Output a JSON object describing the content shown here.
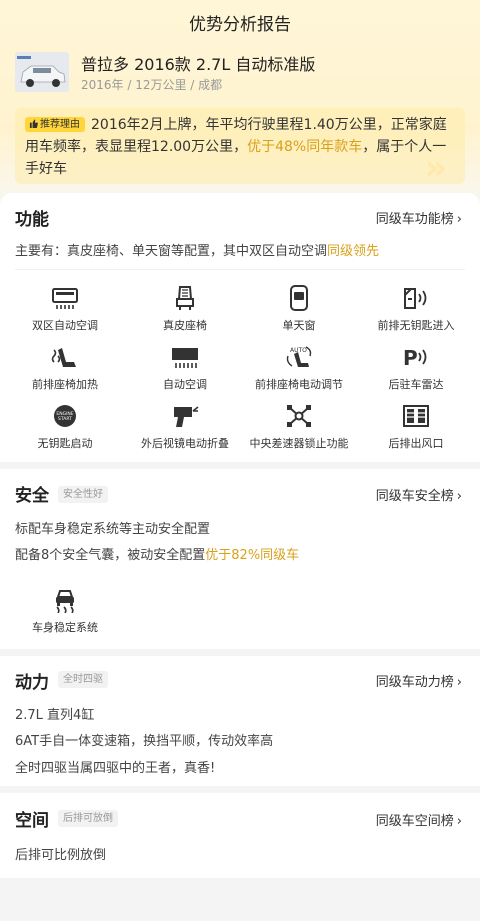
{
  "header": {
    "title": "优势分析报告"
  },
  "car": {
    "name": "普拉多 2016款 2.7L 自动标准版",
    "meta": "2016年 / 12万公里 / 成都"
  },
  "reason": {
    "tag": "推荐理由",
    "text_part1": "2016年2月上牌，年平均行驶里程1.40万公里，正常家庭用车频率，表显里程12.00万公里，",
    "highlight": "优于48%同年款车",
    "text_part2": "，属于个人一手好车"
  },
  "function": {
    "title": "功能",
    "link": "同级车功能榜",
    "summary_main": "主要有：真皮座椅、单天窗等配置，其中双区自动空调",
    "summary_hl": "同级领先",
    "features": [
      {
        "label": "双区自动空调",
        "icon": "dual-zone-ac-icon"
      },
      {
        "label": "真皮座椅",
        "icon": "leather-seat-icon"
      },
      {
        "label": "单天窗",
        "icon": "sunroof-icon"
      },
      {
        "label": "前排无钥匙进入",
        "icon": "keyless-entry-icon"
      },
      {
        "label": "前排座椅加热",
        "icon": "seat-heating-icon"
      },
      {
        "label": "自动空调",
        "icon": "auto-ac-icon"
      },
      {
        "label": "前排座椅电动调节",
        "icon": "power-seat-icon"
      },
      {
        "label": "后驻车雷达",
        "icon": "parking-radar-icon"
      },
      {
        "label": "无钥匙启动",
        "icon": "keyless-start-icon"
      },
      {
        "label": "外后视镜电动折叠",
        "icon": "mirror-fold-icon"
      },
      {
        "label": "中央差速器锁止功能",
        "icon": "diff-lock-icon"
      },
      {
        "label": "后排出风口",
        "icon": "rear-vent-icon"
      }
    ]
  },
  "safety": {
    "title": "安全",
    "tag": "安全性好",
    "link": "同级车安全榜",
    "line1": "标配车身稳定系统等主动安全配置",
    "line2_main": "配备8个安全气囊，被动安全配置",
    "line2_hl": "优于82%同级车",
    "feature": {
      "label": "车身稳定系统",
      "icon": "stability-control-icon"
    }
  },
  "power": {
    "title": "动力",
    "tag": "全时四驱",
    "link": "同级车动力榜",
    "lines": [
      "2.7L 直列4缸",
      "6AT手自一体变速箱，换挡平顺，传动效率高",
      "全时四驱当属四驱中的王者，真香!"
    ]
  },
  "space": {
    "title": "空间",
    "tag": "后排可放倒",
    "link": "同级车空间榜",
    "line": "后排可比例放倒"
  },
  "colors": {
    "accent": "#d9a11a",
    "tag_bg": "#ffd53a",
    "header_bg": "#fff6d8"
  }
}
